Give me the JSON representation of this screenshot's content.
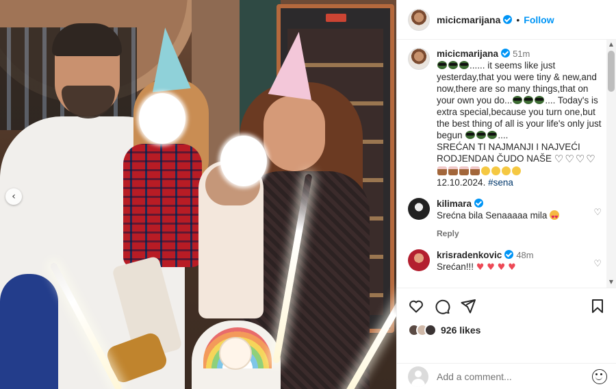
{
  "post": {
    "username": "micicmarijana",
    "follow_label": "Follow",
    "separator": "•"
  },
  "caption": {
    "username": "micicmarijana",
    "time": "51m",
    "line1": "...... it seems like just yesterday,that you were tiny & new,and now,there are so many things,that on your own you do...",
    "line2": ".... Today's is extra special,because you turn one,but the best thing of all is your life's only just begun",
    "line3": "....",
    "line4": "SREĆAN TI NAJMANJI I NAJVEĆI RODJENDAN ČUDO NAŠE",
    "line5": "12.10.2024.",
    "hashtag": "#sena"
  },
  "comments": [
    {
      "username": "kilimara",
      "text": "Srećna bila Senaaaaa mila",
      "reply_label": "Reply",
      "time": ""
    },
    {
      "username": "krisradenkovic",
      "time": "48m",
      "text": "Srećan!!!"
    }
  ],
  "likes": {
    "count_label": "926 likes"
  },
  "add_comment": {
    "placeholder": "Add a comment..."
  },
  "icons": {
    "like": "heart-outline-icon",
    "comment": "comment-bubble-icon",
    "share": "paper-plane-icon",
    "save": "bookmark-icon",
    "prev": "chevron-left-icon",
    "emoji": "smiley-icon"
  },
  "colors": {
    "accent": "#0095f6",
    "heart": "#ed4956",
    "muted": "#737373"
  }
}
